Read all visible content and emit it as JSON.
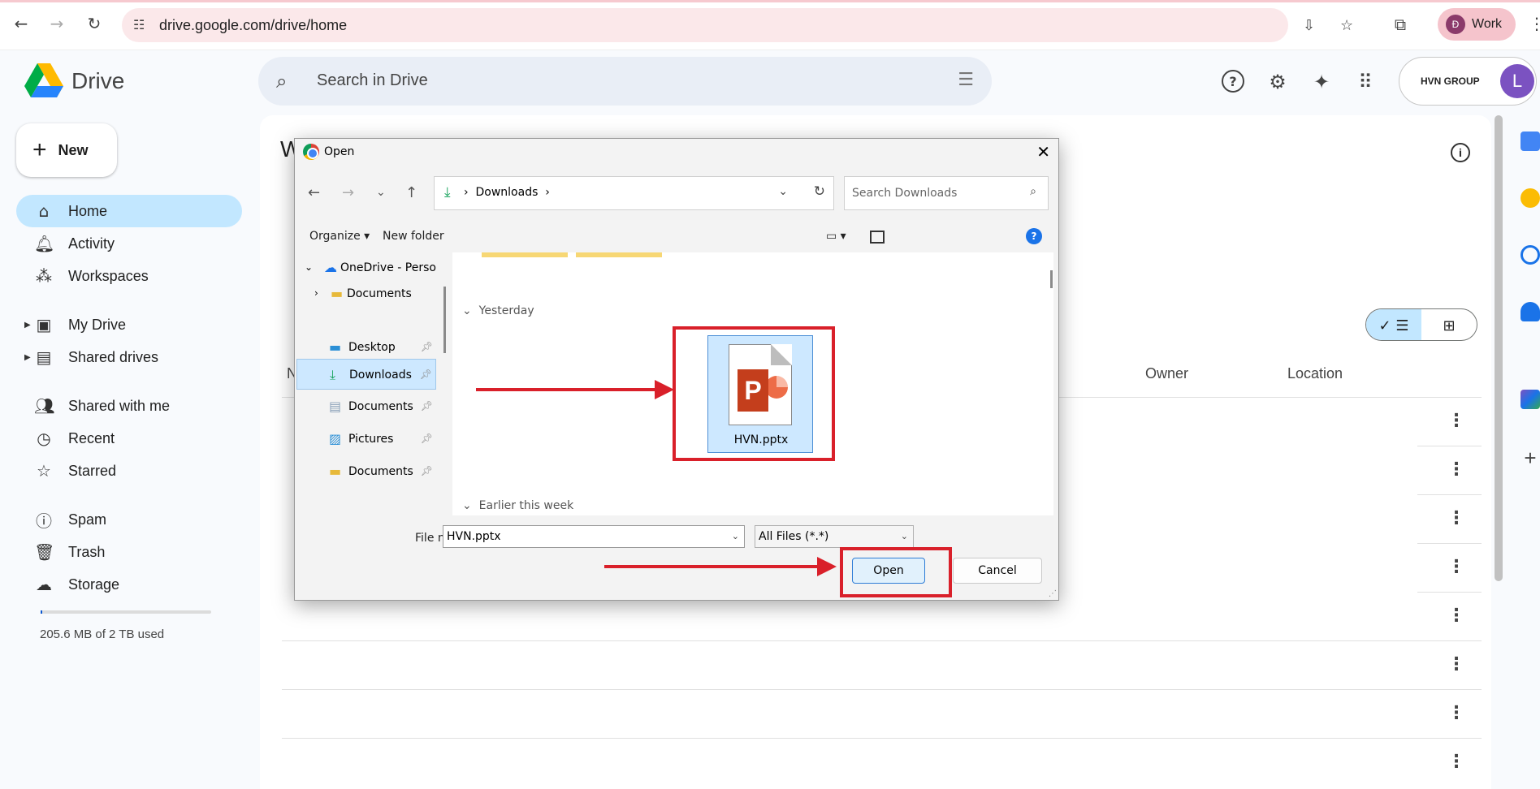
{
  "browser": {
    "url": "drive.google.com/drive/home",
    "profile_initial": "Đ",
    "profile_label": "Work"
  },
  "drive": {
    "app_name": "Drive",
    "search_placeholder": "Search in Drive",
    "account_brand": "HVN GROUP",
    "account_initial": "L",
    "main_heading_partial": "W",
    "new_button": "New",
    "sidebar": [
      {
        "label": "Home"
      },
      {
        "label": "Activity"
      },
      {
        "label": "Workspaces"
      },
      {
        "label": "My Drive"
      },
      {
        "label": "Shared drives"
      },
      {
        "label": "Shared with me"
      },
      {
        "label": "Recent"
      },
      {
        "label": "Starred"
      },
      {
        "label": "Spam"
      },
      {
        "label": "Trash"
      },
      {
        "label": "Storage"
      }
    ],
    "storage_used_text": "205.6 MB of 2 TB used",
    "storage_fraction": 0.0001,
    "columns": {
      "partial_name": "N",
      "owner": "Owner",
      "location": "Location"
    }
  },
  "dialog": {
    "title": "Open",
    "path_folder": "Downloads",
    "search_placeholder": "Search Downloads",
    "organize": "Organize",
    "new_folder": "New folder",
    "nav": [
      {
        "label": "OneDrive - Perso"
      },
      {
        "label": "Documents"
      },
      {
        "label": "Desktop"
      },
      {
        "label": "Downloads"
      },
      {
        "label": "Documents"
      },
      {
        "label": "Pictures"
      },
      {
        "label": "Documents"
      }
    ],
    "groups": {
      "yesterday": "Yesterday",
      "earlier": "Earlier this week"
    },
    "file_name": "HVN.pptx",
    "file_name_label": "File name:",
    "file_name_value": "HVN.pptx",
    "file_type": "All Files (*.*)",
    "open_button": "Open",
    "cancel_button": "Cancel",
    "help": "?"
  },
  "colors": {
    "annotation_red": "#d9202a",
    "selected_blue": "#c2e7ff",
    "avatar_purple": "#7b52c1"
  }
}
